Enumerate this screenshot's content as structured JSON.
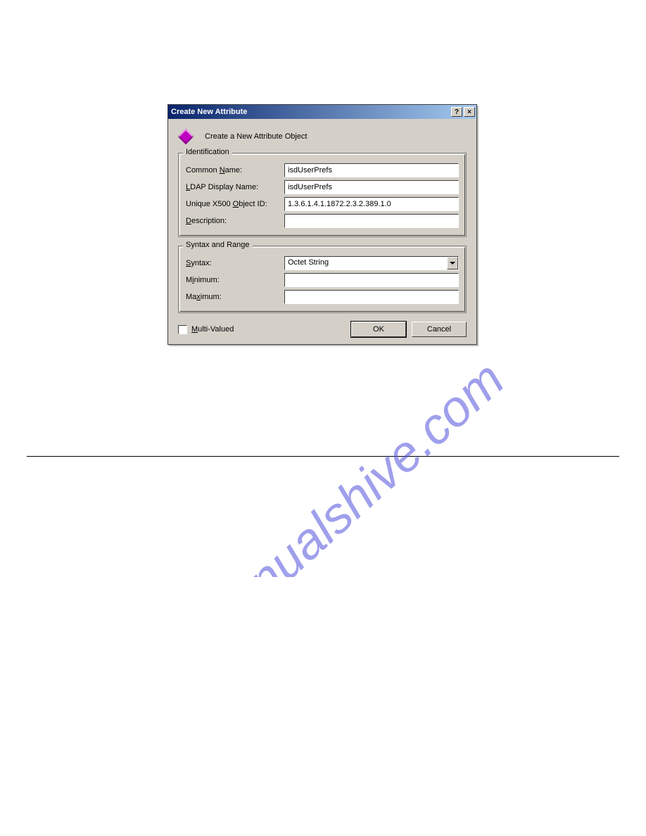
{
  "dialog": {
    "title": "Create New Attribute",
    "help_glyph": "?",
    "close_glyph": "×",
    "header_text": "Create a New Attribute Object",
    "groups": {
      "identification": {
        "legend": "Identification",
        "common_name_label": "Common Name:",
        "common_name_mnemonic": "N",
        "common_name_value": "isdUserPrefs",
        "ldap_label": "LDAP Display Name:",
        "ldap_mnemonic": "L",
        "ldap_value": "isdUserPrefs",
        "oid_label": "Unique X500 Object ID:",
        "oid_mnemonic": "O",
        "oid_value": "1.3.6.1.4.1.1872.2.3.2.389.1.0",
        "desc_label": "Description:",
        "desc_mnemonic": "D",
        "desc_value": ""
      },
      "syntax": {
        "legend": "Syntax and Range",
        "syntax_label": "Syntax:",
        "syntax_mnemonic": "S",
        "syntax_value": "Octet String",
        "min_label": "Minimum:",
        "min_mnemonic": "i",
        "min_value": "",
        "max_label": "Maximum:",
        "max_mnemonic": "x",
        "max_value": ""
      }
    },
    "multivalued_label": "Multi-Valued",
    "multivalued_mnemonic": "M",
    "ok_label": "OK",
    "cancel_label": "Cancel"
  },
  "watermark_text": "manualshive.com"
}
